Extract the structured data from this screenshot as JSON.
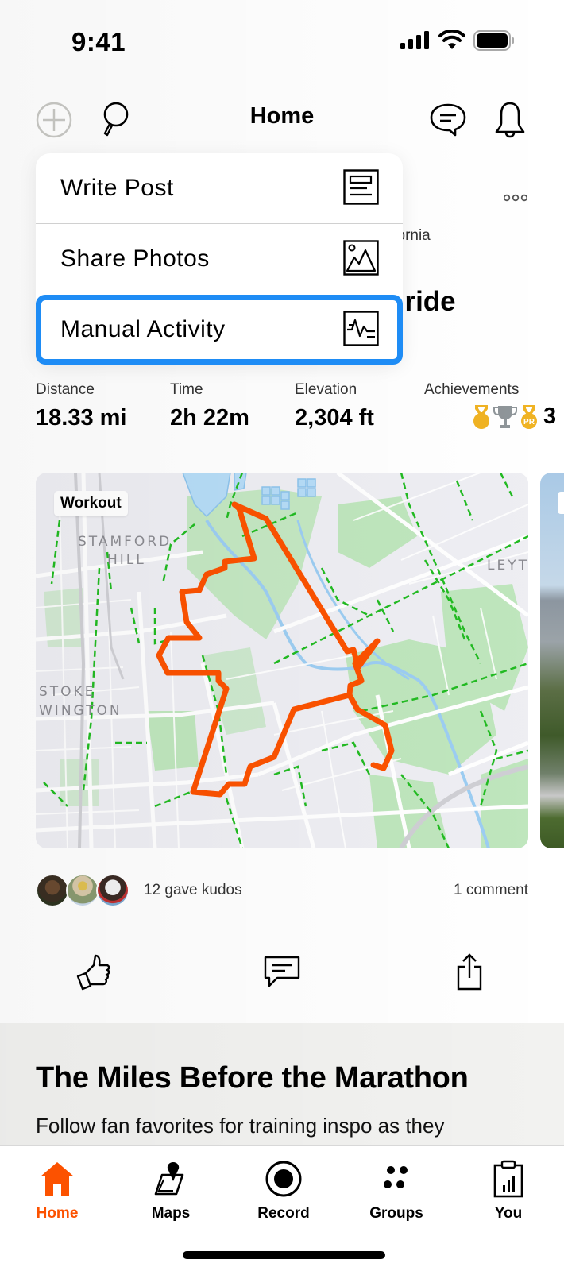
{
  "status_bar": {
    "time": "9:41"
  },
  "header": {
    "title": "Home",
    "icons": [
      "add-circle-icon",
      "search-icon",
      "messages-icon",
      "notifications-bell-icon"
    ]
  },
  "dropdown": {
    "items": [
      {
        "label": "Write Post",
        "icon": "post-icon"
      },
      {
        "label": "Share Photos",
        "icon": "photo-icon"
      },
      {
        "label": "Manual Activity",
        "icon": "activity-graph-icon",
        "selected": true
      }
    ]
  },
  "activity": {
    "location_fragment": "ifornia",
    "title_fragment": "l ride",
    "stats": [
      {
        "label": "Distance",
        "value": "18.33 mi"
      },
      {
        "label": "Time",
        "value": "2h 22m"
      },
      {
        "label": "Elevation",
        "value": "2,304 ft"
      }
    ],
    "achievements": {
      "label": "Achievements",
      "count": "3",
      "icons": [
        "gold-medal-icon",
        "trophy-icon",
        "pr-medal-icon"
      ]
    },
    "map": {
      "badge": "Workout",
      "place_labels": [
        "STAMFORD",
        "HILL",
        "STOKE",
        "WINGTON",
        "LEYTO"
      ]
    },
    "kudos_text": "12 gave kudos",
    "comments_text": "1 comment",
    "actions": [
      "kudos-button",
      "comment-button",
      "share-button"
    ]
  },
  "promo": {
    "title": "The Miles Before the Marathon",
    "text": "Follow fan favorites for training inspo as they"
  },
  "tabbar": {
    "tabs": [
      {
        "label": "Home",
        "active": true
      },
      {
        "label": "Maps"
      },
      {
        "label": "Record"
      },
      {
        "label": "Groups"
      },
      {
        "label": "You"
      }
    ]
  },
  "colors": {
    "brand_orange": "#fc5200",
    "selection_blue": "#1e8cf5",
    "gold": "#f0b323",
    "silver": "#8e9599",
    "route": "#fc5200"
  }
}
